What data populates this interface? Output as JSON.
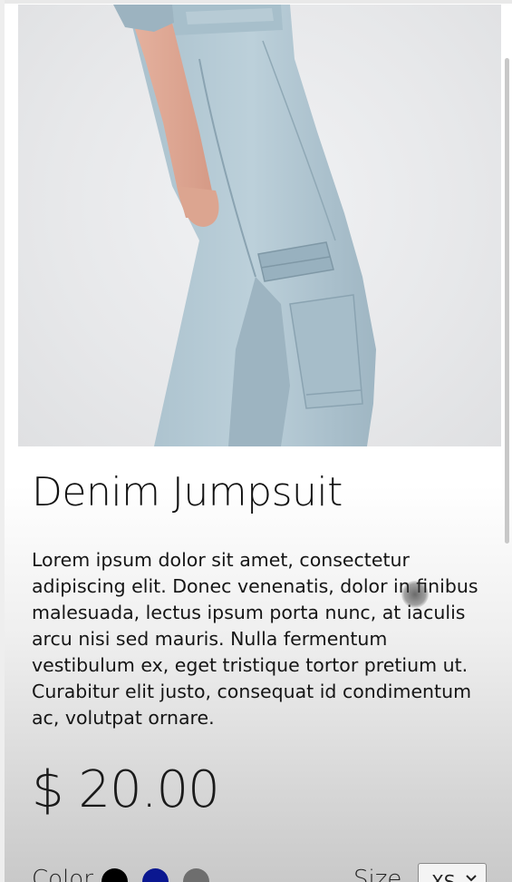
{
  "product": {
    "title": "Denim Jumpsuit",
    "description": "Lorem ipsum dolor sit amet, consectetur adipiscing elit. Donec venenatis, dolor in finibus malesuada, lectus ipsum porta nunc, at iaculis arcu nisi sed mauris. Nulla fermentum vestibulum ex, eget tristique tortor pretium ut. Curabitur elit justo, consequat id condimentum ac, volutpat ornare.",
    "price": "$ 20.00",
    "image_icon": "product-photo-denim-jumpsuit"
  },
  "options": {
    "color_label": "Color",
    "colors": [
      {
        "name": "black",
        "hex": "#000000"
      },
      {
        "name": "navy",
        "hex": "#0a1790"
      },
      {
        "name": "gray",
        "hex": "#6e6e6e"
      }
    ],
    "size_label": "Size",
    "size_value": "XS"
  }
}
